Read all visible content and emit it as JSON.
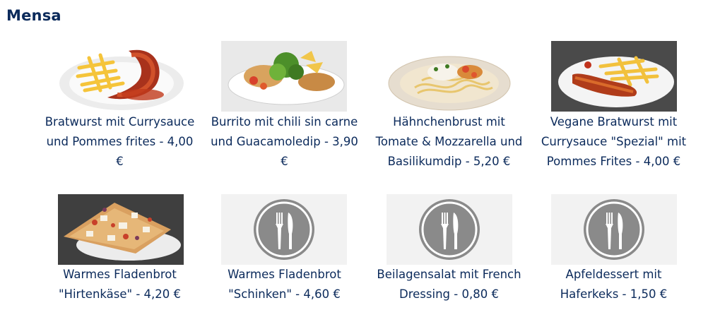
{
  "page": {
    "title": "Mensa"
  },
  "menu": [
    {
      "image": "bratwurst-fries-photo",
      "label": "Bratwurst mit Currysauce\nund Pommes frites - 4,00\n€"
    },
    {
      "image": "burrito-salad-photo",
      "label": "Burrito mit chili sin carne\nund Guacamoledip - 3,90\n€"
    },
    {
      "image": "chicken-pasta-photo",
      "label": "Hähnchenbrust mit\nTomate & Mozzarella und\nBasilikumdip - 5,20 €"
    },
    {
      "image": "vegan-bratwurst-photo",
      "label": "Vegane Bratwurst mit\nCurrysauce \"Spezial\" mit\nPommes Frites - 4,00 €"
    },
    {
      "image": "flatbread-feta-photo",
      "label": "Warmes Fladenbrot\n\"Hirtenkäse\" - 4,20 €"
    },
    {
      "image": "fork-knife-placeholder-icon",
      "label": "Warmes Fladenbrot\n\"Schinken\" - 4,60 €"
    },
    {
      "image": "fork-knife-placeholder-icon",
      "label": "Beilagensalat mit French\nDressing - 0,80 €"
    },
    {
      "image": "fork-knife-placeholder-icon",
      "label": "Apfeldessert mit\nHaferkeks - 1,50 €"
    }
  ]
}
